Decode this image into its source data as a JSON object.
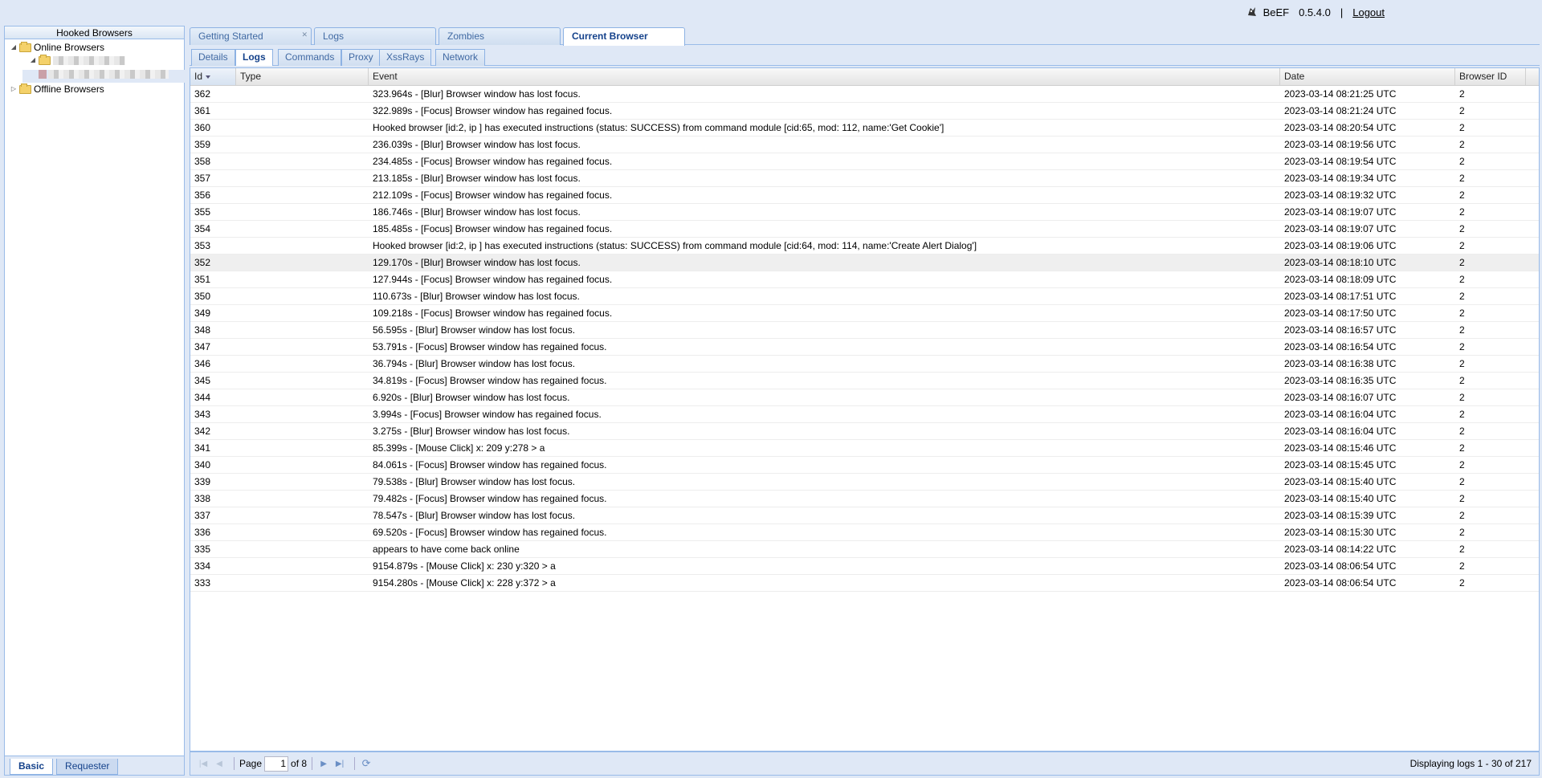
{
  "header": {
    "app_name": "BeEF",
    "version": "0.5.4.0",
    "separator": "|",
    "logout": "Logout"
  },
  "left": {
    "title": "Hooked Browsers",
    "online": "Online Browsers",
    "offline": "Offline Browsers",
    "tabs": [
      "Basic",
      "Requester"
    ]
  },
  "tabs": [
    "Getting Started",
    "Logs",
    "Zombies",
    "Current Browser"
  ],
  "subtabs": [
    "Details",
    "Logs",
    "Commands",
    "Proxy",
    "XssRays",
    "Network"
  ],
  "grid": {
    "columns": [
      "Id",
      "Type",
      "Event",
      "Date",
      "Browser ID"
    ],
    "rows": [
      [
        "362",
        "",
        "323.964s - [Blur] Browser window has lost focus.",
        "2023-03-14 08:21:25 UTC",
        "2"
      ],
      [
        "361",
        "",
        "322.989s - [Focus] Browser window has regained focus.",
        "2023-03-14 08:21:24 UTC",
        "2"
      ],
      [
        "360",
        "",
        "Hooked browser [id:2, ip            ] has executed instructions (status: SUCCESS) from command module [cid:65, mod: 112, name:'Get Cookie']",
        "2023-03-14 08:20:54 UTC",
        "2"
      ],
      [
        "359",
        "",
        "236.039s - [Blur] Browser window has lost focus.",
        "2023-03-14 08:19:56 UTC",
        "2"
      ],
      [
        "358",
        "",
        "234.485s - [Focus] Browser window has regained focus.",
        "2023-03-14 08:19:54 UTC",
        "2"
      ],
      [
        "357",
        "",
        "213.185s - [Blur] Browser window has lost focus.",
        "2023-03-14 08:19:34 UTC",
        "2"
      ],
      [
        "356",
        "",
        "212.109s - [Focus] Browser window has regained focus.",
        "2023-03-14 08:19:32 UTC",
        "2"
      ],
      [
        "355",
        "",
        "186.746s - [Blur] Browser window has lost focus.",
        "2023-03-14 08:19:07 UTC",
        "2"
      ],
      [
        "354",
        "",
        "185.485s - [Focus] Browser window has regained focus.",
        "2023-03-14 08:19:07 UTC",
        "2"
      ],
      [
        "353",
        "",
        "Hooked browser [id:2, ip               ] has executed instructions (status: SUCCESS) from command module [cid:64, mod: 114, name:'Create Alert Dialog']",
        "2023-03-14 08:19:06 UTC",
        "2"
      ],
      [
        "352",
        "",
        "129.170s - [Blur] Browser window has lost focus.",
        "2023-03-14 08:18:10 UTC",
        "2"
      ],
      [
        "351",
        "",
        "127.944s - [Focus] Browser window has regained focus.",
        "2023-03-14 08:18:09 UTC",
        "2"
      ],
      [
        "350",
        "",
        "110.673s - [Blur] Browser window has lost focus.",
        "2023-03-14 08:17:51 UTC",
        "2"
      ],
      [
        "349",
        "",
        "109.218s - [Focus] Browser window has regained focus.",
        "2023-03-14 08:17:50 UTC",
        "2"
      ],
      [
        "348",
        "",
        "56.595s - [Blur] Browser window has lost focus.",
        "2023-03-14 08:16:57 UTC",
        "2"
      ],
      [
        "347",
        "",
        "53.791s - [Focus] Browser window has regained focus.",
        "2023-03-14 08:16:54 UTC",
        "2"
      ],
      [
        "346",
        "",
        "36.794s - [Blur] Browser window has lost focus.",
        "2023-03-14 08:16:38 UTC",
        "2"
      ],
      [
        "345",
        "",
        "34.819s - [Focus] Browser window has regained focus.",
        "2023-03-14 08:16:35 UTC",
        "2"
      ],
      [
        "344",
        "",
        "6.920s - [Blur] Browser window has lost focus.",
        "2023-03-14 08:16:07 UTC",
        "2"
      ],
      [
        "343",
        "",
        "3.994s - [Focus] Browser window has regained focus.",
        "2023-03-14 08:16:04 UTC",
        "2"
      ],
      [
        "342",
        "",
        "3.275s - [Blur] Browser window has lost focus.",
        "2023-03-14 08:16:04 UTC",
        "2"
      ],
      [
        "341",
        "",
        "85.399s - [Mouse Click] x: 209 y:278 > a",
        "2023-03-14 08:15:46 UTC",
        "2"
      ],
      [
        "340",
        "",
        "84.061s - [Focus] Browser window has regained focus.",
        "2023-03-14 08:15:45 UTC",
        "2"
      ],
      [
        "339",
        "",
        "79.538s - [Blur] Browser window has lost focus.",
        "2023-03-14 08:15:40 UTC",
        "2"
      ],
      [
        "338",
        "",
        "79.482s - [Focus] Browser window has regained focus.",
        "2023-03-14 08:15:40 UTC",
        "2"
      ],
      [
        "337",
        "",
        "78.547s - [Blur] Browser window has lost focus.",
        "2023-03-14 08:15:39 UTC",
        "2"
      ],
      [
        "336",
        "",
        "69.520s - [Focus] Browser window has regained focus.",
        "2023-03-14 08:15:30 UTC",
        "2"
      ],
      [
        "335",
        "",
        "              appears to have come back online",
        "2023-03-14 08:14:22 UTC",
        "2"
      ],
      [
        "334",
        "",
        "9154.879s - [Mouse Click] x: 230 y:320 > a",
        "2023-03-14 08:06:54 UTC",
        "2"
      ],
      [
        "333",
        "",
        "9154.280s - [Mouse Click] x: 228 y:372 > a",
        "2023-03-14 08:06:54 UTC",
        "2"
      ]
    ]
  },
  "pager": {
    "page_label": "Page",
    "page_value": "1",
    "of_label": "of 8",
    "display": "Displaying logs 1 - 30 of 217"
  }
}
